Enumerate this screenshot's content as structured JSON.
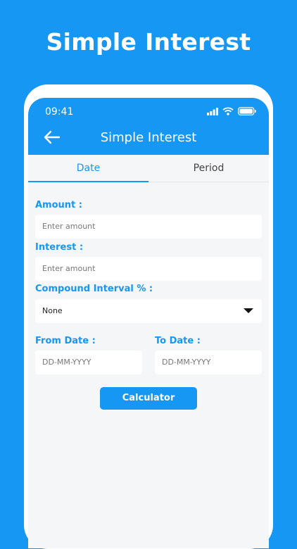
{
  "promo": {
    "title": "Simple Interest"
  },
  "status": {
    "time": "09:41"
  },
  "appbar": {
    "title": "Simple Interest"
  },
  "tabs": [
    {
      "label": "Date",
      "active": true
    },
    {
      "label": "Period",
      "active": false
    }
  ],
  "form": {
    "amount_label": "Amount :",
    "amount_placeholder": "Enter amount",
    "interest_label": "Interest :",
    "interest_placeholder": "Enter amount",
    "compound_label": "Compound Interval % :",
    "compound_value": "None",
    "from_label": "From Date :",
    "from_placeholder": "DD-MM-YYYY",
    "to_label": "To Date :",
    "to_placeholder": "DD-MM-YYYY",
    "calculate_label": "Calculator"
  },
  "colors": {
    "accent": "#1697f3",
    "background": "#f5f6f8"
  }
}
